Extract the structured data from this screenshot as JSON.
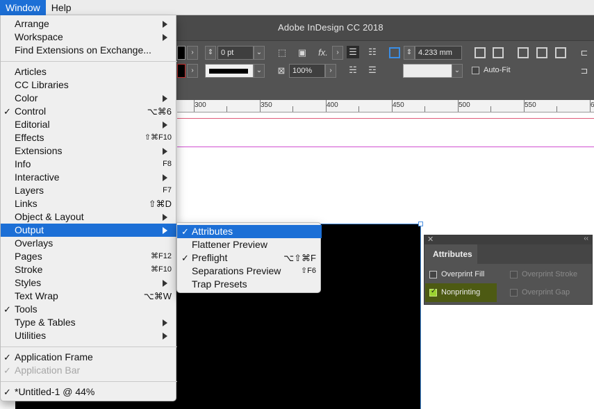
{
  "menubar": {
    "window": "Window",
    "help": "Help"
  },
  "app": {
    "title": "Adobe InDesign CC 2018"
  },
  "controlbar": {
    "stroke_weight": "0 pt",
    "opacity": "100%",
    "ref_value": "4.233 mm",
    "autofit_label": "Auto-Fit",
    "fx_label": "fx."
  },
  "ruler": {
    "labels": [
      "300",
      "350",
      "400",
      "450",
      "500",
      "550",
      "6"
    ]
  },
  "window_menu": {
    "items": [
      {
        "label": "Arrange",
        "check": "",
        "shortcut": "",
        "submenu": true
      },
      {
        "label": "Workspace",
        "check": "",
        "shortcut": "",
        "submenu": true
      },
      {
        "label": "Find Extensions on Exchange...",
        "check": "",
        "shortcut": "",
        "submenu": false
      },
      {
        "label": "Articles",
        "check": "",
        "shortcut": "",
        "submenu": false
      },
      {
        "label": "CC Libraries",
        "check": "",
        "shortcut": "",
        "submenu": false
      },
      {
        "label": "Color",
        "check": "",
        "shortcut": "",
        "submenu": true
      },
      {
        "label": "Control",
        "check": "✓",
        "shortcut": "⌥⌘6",
        "submenu": false
      },
      {
        "label": "Editorial",
        "check": "",
        "shortcut": "",
        "submenu": true
      },
      {
        "label": "Effects",
        "check": "",
        "shortcut": "⇧⌘F10",
        "submenu": false
      },
      {
        "label": "Extensions",
        "check": "",
        "shortcut": "",
        "submenu": true
      },
      {
        "label": "Info",
        "check": "",
        "shortcut": "F8",
        "submenu": false
      },
      {
        "label": "Interactive",
        "check": "",
        "shortcut": "",
        "submenu": true
      },
      {
        "label": "Layers",
        "check": "",
        "shortcut": "F7",
        "submenu": false
      },
      {
        "label": "Links",
        "check": "",
        "shortcut": "⇧⌘D",
        "submenu": false
      },
      {
        "label": "Object & Layout",
        "check": "",
        "shortcut": "",
        "submenu": true
      },
      {
        "label": "Output",
        "check": "",
        "shortcut": "",
        "submenu": true
      },
      {
        "label": "Overlays",
        "check": "",
        "shortcut": "",
        "submenu": false
      },
      {
        "label": "Pages",
        "check": "",
        "shortcut": "⌘F12",
        "submenu": false
      },
      {
        "label": "Stroke",
        "check": "",
        "shortcut": "⌘F10",
        "submenu": false
      },
      {
        "label": "Styles",
        "check": "",
        "shortcut": "",
        "submenu": true
      },
      {
        "label": "Text Wrap",
        "check": "",
        "shortcut": "⌥⌘W",
        "submenu": false
      },
      {
        "label": "Tools",
        "check": "✓",
        "shortcut": "",
        "submenu": false
      },
      {
        "label": "Type & Tables",
        "check": "",
        "shortcut": "",
        "submenu": true
      },
      {
        "label": "Utilities",
        "check": "",
        "shortcut": "",
        "submenu": true
      },
      {
        "label": "Application Frame",
        "check": "✓",
        "shortcut": "",
        "submenu": false
      },
      {
        "label": "Application Bar",
        "check": "✓",
        "shortcut": "",
        "submenu": false
      },
      {
        "label": "*Untitled-1 @ 44%",
        "check": "✓",
        "shortcut": "",
        "submenu": false
      }
    ]
  },
  "output_submenu": {
    "items": [
      {
        "label": "Attributes",
        "check": "✓",
        "shortcut": ""
      },
      {
        "label": "Flattener Preview",
        "check": "",
        "shortcut": ""
      },
      {
        "label": "Preflight",
        "check": "✓",
        "shortcut": "⌥⇧⌘F"
      },
      {
        "label": "Separations Preview",
        "check": "",
        "shortcut": "⇧F6"
      },
      {
        "label": "Trap Presets",
        "check": "",
        "shortcut": ""
      }
    ]
  },
  "attributes_panel": {
    "tab": "Attributes",
    "overprint_fill": "Overprint Fill",
    "overprint_stroke": "Overprint Stroke",
    "nonprinting": "Nonprinting",
    "overprint_gap": "Overprint Gap"
  },
  "colors": {
    "menu_highlight": "#1c6fd6",
    "checkbox_checked": "#9bd22f",
    "nonprinting_highlight": "#4d5a13"
  }
}
